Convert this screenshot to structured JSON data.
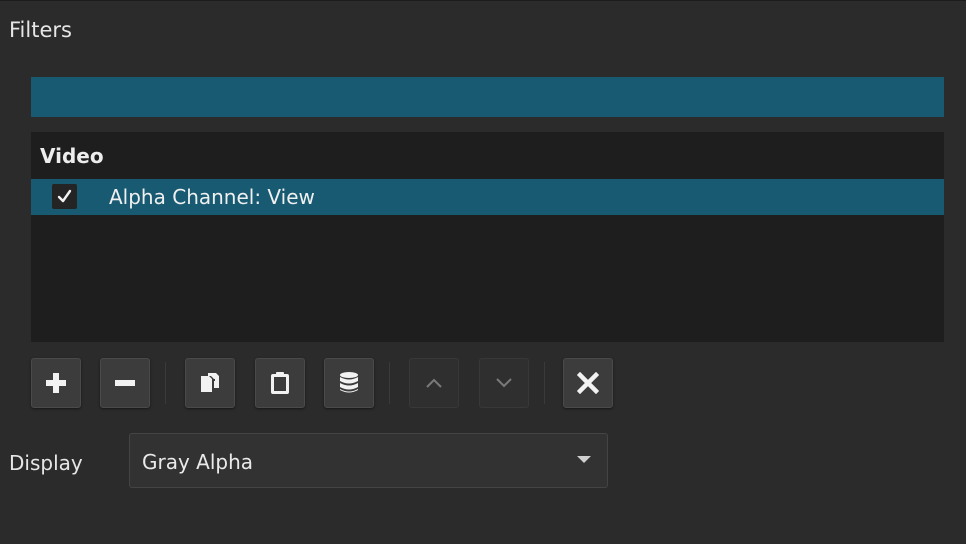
{
  "panel": {
    "title": "Filters"
  },
  "filter_list": {
    "group_header": "Video",
    "items": [
      {
        "label": "Alpha Channel: View",
        "enabled": true,
        "selected": true
      }
    ]
  },
  "toolbar": {
    "buttons": [
      {
        "name": "add-filter",
        "icon": "plus-icon",
        "enabled": true
      },
      {
        "name": "remove-filter",
        "icon": "minus-icon",
        "enabled": true
      },
      {
        "name": "copy-filters",
        "icon": "copy-icon",
        "enabled": true
      },
      {
        "name": "paste-filters",
        "icon": "clipboard-icon",
        "enabled": true
      },
      {
        "name": "save-preset",
        "icon": "database-icon",
        "enabled": true
      },
      {
        "name": "move-up",
        "icon": "chevron-up-icon",
        "enabled": false
      },
      {
        "name": "move-down",
        "icon": "chevron-down-icon",
        "enabled": false
      },
      {
        "name": "deselect",
        "icon": "close-icon",
        "enabled": true
      }
    ]
  },
  "display": {
    "label": "Display",
    "selected": "Gray Alpha"
  },
  "colors": {
    "background": "#2b2b2b",
    "accent": "#175a72",
    "list_background": "#1e1e1e"
  }
}
